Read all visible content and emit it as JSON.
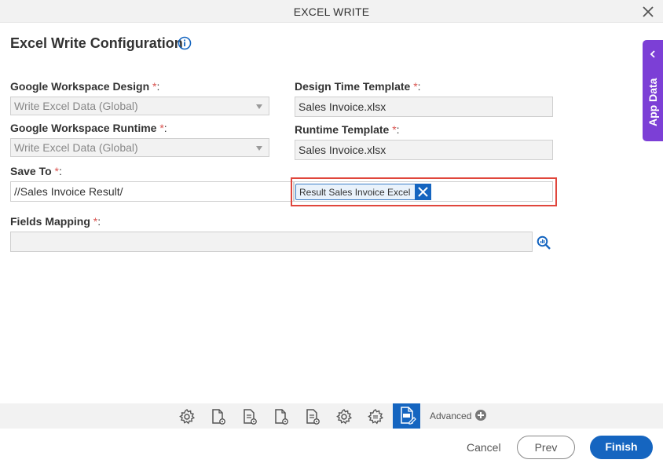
{
  "window": {
    "title": "EXCEL WRITE",
    "close_icon": "close-icon"
  },
  "form": {
    "heading": "Excel Write Configuration",
    "info_icon": "info-icon",
    "required_mark": "*",
    "colon": ":",
    "google_design": {
      "label": "Google Workspace Design",
      "value": "Write Excel Data (Global)"
    },
    "google_runtime": {
      "label": "Google Workspace Runtime",
      "value": "Write Excel Data (Global)"
    },
    "design_template": {
      "label": "Design Time Template",
      "value": "Sales Invoice.xlsx"
    },
    "runtime_template": {
      "label": "Runtime Template",
      "value": "Sales Invoice.xlsx"
    },
    "save_to": {
      "label": "Save To",
      "path": "//Sales Invoice Result/",
      "tag": "Result Sales Invoice Excel"
    },
    "fields_mapping": {
      "label": "Fields Mapping",
      "value": ""
    }
  },
  "sidebar": {
    "app_data_label": "App Data"
  },
  "toolbar": {
    "icons": [
      "gear-icon",
      "document-gear-icon",
      "document-list-gear-icon",
      "document-gear-icon",
      "document-list-gear-icon",
      "gear-icon",
      "gear-list-icon",
      "excel-write-icon"
    ],
    "advanced_label": "Advanced"
  },
  "footer": {
    "cancel_label": "Cancel",
    "prev_label": "Prev",
    "finish_label": "Finish"
  },
  "colors": {
    "accent": "#1565c0",
    "app_data": "#7c3fd6",
    "highlight": "#e0463c",
    "required": "#d9534f"
  }
}
